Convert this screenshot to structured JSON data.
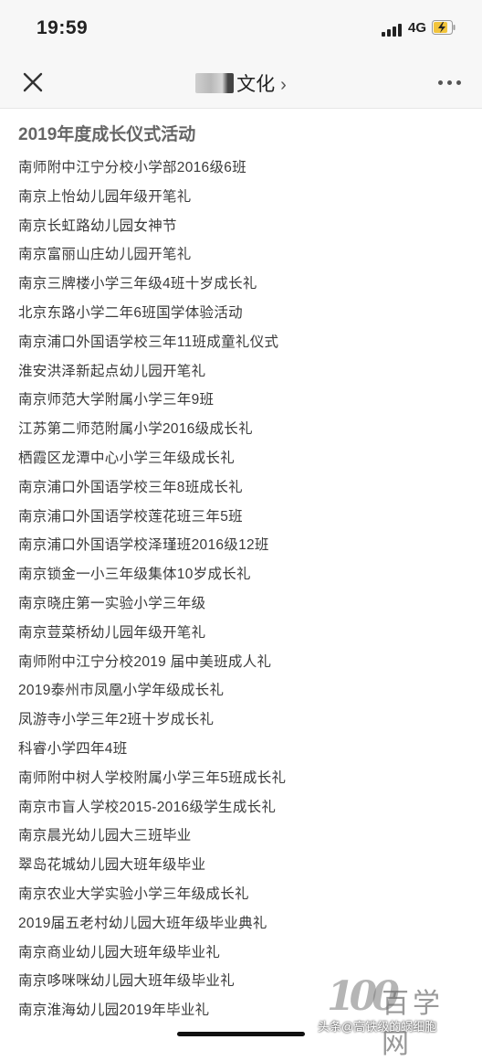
{
  "status_bar": {
    "time": "19:59",
    "network": "4G",
    "icons": [
      "signal-icon",
      "battery-charging-icon"
    ]
  },
  "nav": {
    "title": "文化",
    "close_icon": "close-icon",
    "more_icon": "more-icon",
    "chevron": "›"
  },
  "section": {
    "title": "2019年度成长仪式活动",
    "items": [
      "南师附中江宁分校小学部2016级6班",
      "南京上怡幼儿园年级开笔礼",
      "南京长虹路幼儿园女神节",
      "南京富丽山庄幼儿园开笔礼",
      "南京三牌楼小学三年级4班十岁成长礼",
      "北京东路小学二年6班国学体验活动",
      "南京浦口外国语学校三年11班成童礼仪式",
      "淮安洪泽新起点幼儿园开笔礼",
      "南京师范大学附属小学三年9班",
      "江苏第二师范附属小学2016级成长礼",
      "栖霞区龙潭中心小学三年级成长礼",
      "南京浦口外国语学校三年8班成长礼",
      "南京浦口外国语学校莲花班三年5班",
      "南京浦口外国语学校泽瑾班2016级12班",
      "南京锁金一小三年级集体10岁成长礼",
      "南京晓庄第一实验小学三年级",
      "南京荳菜桥幼儿园年级开笔礼",
      "南师附中江宁分校2019 届中美班成人礼",
      "2019泰州市凤凰小学年级成长礼",
      "凤游寺小学三年2班十岁成长礼",
      "科睿小学四年4班",
      "南师附中树人学校附属小学三年5班成长礼",
      "南京市盲人学校2015-2016级学生成长礼",
      "南京晨光幼儿园大三班毕业",
      "翠岛花城幼儿园大班年级毕业",
      "南京农业大学实验小学三年级成长礼",
      "2019届五老村幼儿园大班年级毕业典礼",
      "南京商业幼儿园大班年级毕业礼",
      "南京哆咪咪幼儿园大班年级毕业礼",
      "南京淮海幼儿园2019年毕业礼"
    ]
  },
  "watermark": {
    "logo": "100",
    "brand": "百学网",
    "author": "头条@高铁级的蜗细胞"
  }
}
